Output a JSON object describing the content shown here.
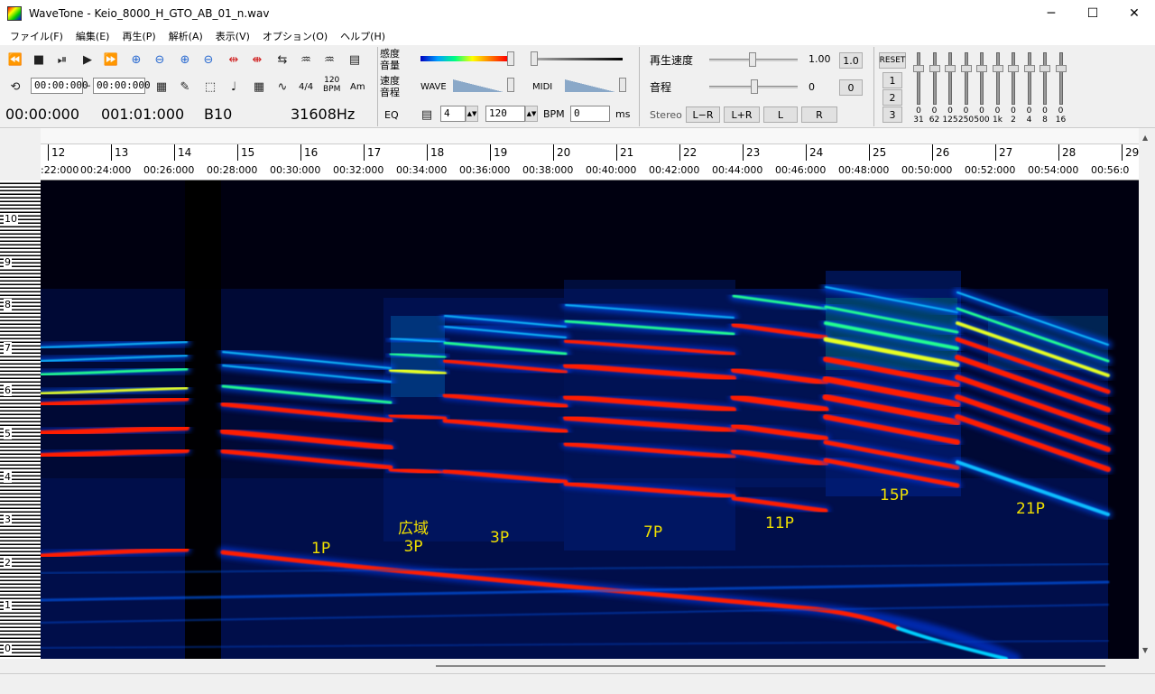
{
  "window": {
    "title": "WaveTone - Keio_8000_H_GTO_AB_01_n.wav",
    "minimize": "─",
    "maximize": "☐",
    "close": "✕"
  },
  "menu": [
    "ファイル(F)",
    "編集(E)",
    "再生(P)",
    "解析(A)",
    "表示(V)",
    "オプション(O)",
    "ヘルプ(H)"
  ],
  "toolbar": {
    "sensitivity_label": "感度",
    "volume_label": "音量",
    "speed_label": "速度",
    "pitch_label": "音程",
    "eq_label": "EQ",
    "loop_start": "00:00:000",
    "loop_dash": "–",
    "loop_end": "00:00:000",
    "time_sig": "4/4",
    "bpm_icon_top": "120",
    "bpm_icon_bottom": "BPM",
    "chord_icon": "Am",
    "position_time": "00:00:000",
    "position_bar": "001:01:000",
    "note": "B10",
    "freq": "31608Hz",
    "wave_label": "WAVE",
    "midi_label": "MIDI",
    "beats_value": "4",
    "bpm_value": "120",
    "bpm_label": "BPM",
    "ms_value": "0",
    "ms_label": "ms",
    "playback_speed_label": "再生速度",
    "playback_speed_value": "1.00",
    "playback_speed_reset": "1.0",
    "pitch_shift_label": "音程",
    "pitch_shift_value": "0",
    "pitch_shift_reset": "0",
    "stereo_label": "Stereo",
    "lr_minus": "L−R",
    "lr_plus": "L+R",
    "left": "L",
    "right": "R",
    "eq_reset": "RESET",
    "eq_preset1": "1",
    "eq_preset2": "2",
    "eq_preset3": "3",
    "eq_values": [
      "0",
      "0",
      "0",
      "0",
      "0",
      "0",
      "0",
      "0",
      "0",
      "0"
    ],
    "eq_bands": [
      "31",
      "62",
      "125",
      "250",
      "500",
      "1k",
      "2",
      "4",
      "8",
      "16"
    ]
  },
  "ruler": {
    "bars": [
      "12",
      "13",
      "14",
      "15",
      "16",
      "17",
      "18",
      "19",
      "20",
      "21",
      "22",
      "23",
      "24",
      "25",
      "26",
      "27",
      "28",
      "29"
    ],
    "times": [
      ":22:000",
      "00:24:000",
      "00:26:000",
      "00:28:000",
      "00:30:000",
      "00:32:000",
      "00:34:000",
      "00:36:000",
      "00:38:000",
      "00:40:000",
      "00:42:000",
      "00:44:000",
      "00:46:000",
      "00:48:000",
      "00:50:000",
      "00:52:000",
      "00:54:000",
      "00:56:0"
    ]
  },
  "piano_octaves": [
    "10",
    "9",
    "8",
    "7",
    "6",
    "5",
    "4",
    "3",
    "2",
    "1",
    "0"
  ],
  "annotations": {
    "a1": "1P",
    "a2_line1": "広域",
    "a2_line2": "3P",
    "a3": "3P",
    "a4": "7P",
    "a5": "11P",
    "a6": "15P",
    "a7": "21P"
  },
  "colors": {
    "annotation": "#f0e000",
    "spectro_bg": "#000000"
  }
}
